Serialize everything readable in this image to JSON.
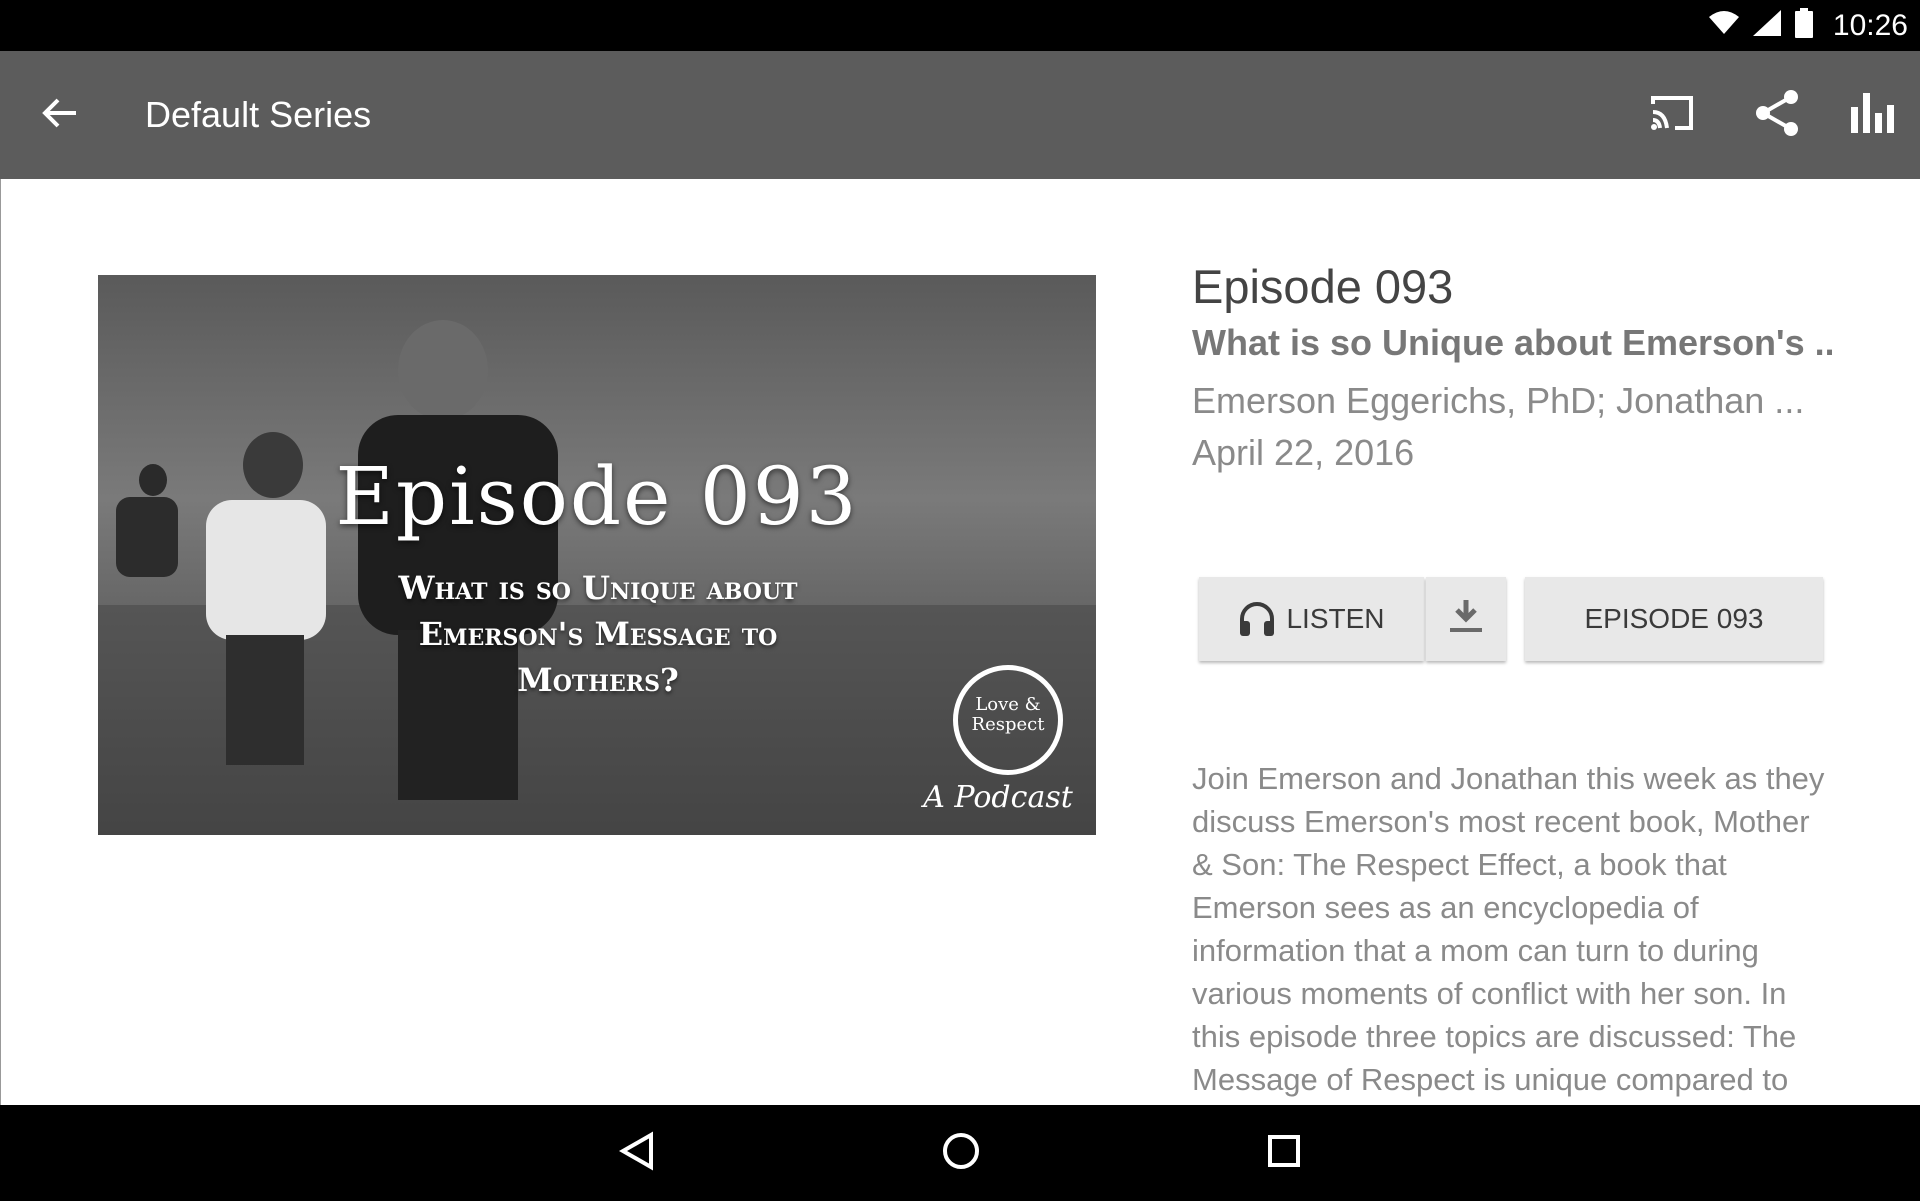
{
  "status_bar": {
    "time": "10:26"
  },
  "app_bar": {
    "title": "Default Series"
  },
  "artwork": {
    "title": "Episode 093",
    "subtitle": "What is so Unique about Emerson's Message to Mothers?",
    "logo_text": "Love & Respect",
    "logo_tag": "A Podcast"
  },
  "episode": {
    "number": "Episode 093",
    "title": "What is so Unique about Emerson's ...",
    "authors": "Emerson Eggerichs, PhD; Jonathan ...",
    "date": "April 22, 2016"
  },
  "actions": {
    "listen_label": "LISTEN",
    "episode_label": "EPISODE 093"
  },
  "description": "Join Emerson and Jonathan this week as they discuss Emerson's most recent book, Mother & Son: The Respect Effect, a book that Emerson sees as an encyclopedia of information that a mom can turn to during various moments of conflict with her son. In this episode three topics are discussed: The Message of Respect is unique compared to",
  "colors": {
    "app_bar": "#5c5c5c",
    "status_bar": "#000000",
    "button_bg": "#e8e8e8",
    "text_secondary": "#8a8a8a"
  },
  "icons": {
    "back": "arrow-back-icon",
    "cast": "cast-icon",
    "share": "share-icon",
    "stats": "bar-chart-icon",
    "listen": "headphones-icon",
    "download": "download-icon"
  }
}
